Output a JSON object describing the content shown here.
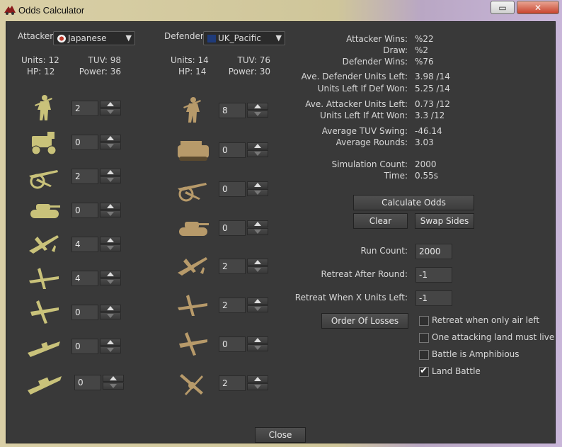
{
  "window": {
    "title": "Odds Calculator",
    "restore_symbol": "▭",
    "close_symbol": "✕"
  },
  "attacker": {
    "label": "Attacker:",
    "nation": "Japanese",
    "flag_color": "#c0392b",
    "units_text": "Units: 12",
    "tuv_text": "TUV: 98",
    "hp_text": "HP: 12",
    "power_text": "Power: 36",
    "counts": [
      "2",
      "0",
      "2",
      "0",
      "4",
      "4",
      "0",
      "0",
      "0"
    ],
    "icons": [
      "infantry-icon",
      "artillery-tractor-icon",
      "artillery-gun-icon",
      "tank-icon",
      "fighter-icon",
      "tactical-bomber-icon",
      "bomber-icon",
      "destroyer-icon",
      "battleship-icon"
    ]
  },
  "defender": {
    "label": "Defender:",
    "nation": "UK_Pacific",
    "flag_color": "#1f3b7a",
    "units_text": "Units: 14",
    "tuv_text": "TUV: 76",
    "hp_text": "HP: 14",
    "power_text": "Power: 30",
    "counts": [
      "8",
      "0",
      "0",
      "0",
      "2",
      "2",
      "0",
      "2"
    ],
    "icons": [
      "infantry-icon",
      "mech-infantry-icon",
      "artillery-gun-icon",
      "tank-icon",
      "fighter-icon",
      "tactical-bomber-icon",
      "bomber-icon",
      "aa-gun-icon"
    ]
  },
  "results": {
    "rows": [
      {
        "label": "Attacker Wins:",
        "value": "%22"
      },
      {
        "label": "Draw:",
        "value": "%2"
      },
      {
        "label": "Defender Wins:",
        "value": "%76"
      },
      {
        "label": "Ave. Defender Units Left:",
        "value": "3.98 /14"
      },
      {
        "label": "Units Left If Def Won:",
        "value": "5.25 /14"
      },
      {
        "label": "Ave. Attacker Units Left:",
        "value": "0.73 /12"
      },
      {
        "label": "Units Left If Att Won:",
        "value": "3.3 /12"
      },
      {
        "label": "Average TUV Swing:",
        "value": "-46.14"
      },
      {
        "label": "Average Rounds:",
        "value": "3.03"
      },
      {
        "label": "Simulation Count:",
        "value": "2000"
      },
      {
        "label": "Time:",
        "value": "0.55s"
      }
    ]
  },
  "buttons": {
    "calculate": "Calculate Odds",
    "clear": "Clear",
    "swap": "Swap Sides",
    "order_of_losses": "Order Of Losses",
    "close": "Close"
  },
  "settings": {
    "run_count_label": "Run Count:",
    "run_count_value": "2000",
    "retreat_after_label": "Retreat After Round:",
    "retreat_after_value": "-1",
    "retreat_when_label": "Retreat When X Units Left:",
    "retreat_when_value": "-1"
  },
  "options": [
    {
      "label": "Retreat when only air left",
      "checked": false
    },
    {
      "label": "One attacking land must live",
      "checked": false
    },
    {
      "label": "Battle is Amphibious",
      "checked": false
    },
    {
      "label": "Land Battle",
      "checked": true
    }
  ],
  "colors": {
    "dialog_bg": "#393939",
    "icon_gold": "#c9c27a",
    "icon_bronze": "#b79a6a"
  }
}
